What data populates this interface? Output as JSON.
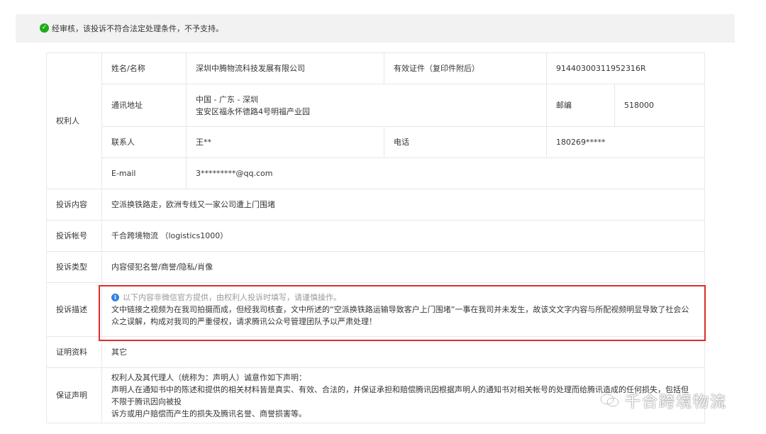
{
  "notice": {
    "text": "经审核，该投诉不符合法定处理条件，不予支持。"
  },
  "rights_holder": {
    "section_label": "权利人",
    "name_label": "姓名/名称",
    "name_value": "深圳中腾物流科技发展有限公司",
    "id_label": "有效证件（复印件附后）",
    "id_value": "91440300311952316R",
    "address_label": "通讯地址",
    "address_line1": "中国 - 广东 - 深圳",
    "address_line2": "宝安区福永怀德路4号明福产业园",
    "postcode_label": "邮编",
    "postcode_value": "518000",
    "contact_label": "联系人",
    "contact_value": "王**",
    "phone_label": "电话",
    "phone_value": "180269*****",
    "email_label": "E-mail",
    "email_value": "3*********@qq.com"
  },
  "complaint": {
    "content_label": "投诉内容",
    "content_value": "空派换铁路走，欧洲专线又一家公司遭上门围堵",
    "account_label": "投诉帐号",
    "account_value": "千合跨境物流 （logistics1000）",
    "type_label": "投诉类型",
    "type_value": "内容侵犯名誉/商誉/隐私/肖像",
    "desc_label": "投诉描述",
    "desc_tip": "以下内容非微信官方提供，由权利人投诉时填写，请谨慎操作。",
    "desc_text": "文中链接之视频为在我司拍摄而成，但经我司核查，文中所述的“空派换铁路运输导致客户上门围堵”一事在我司并未发生，故该文文字内容与所配视频明显导致了社会公众之误解，构成对我司的严重侵权，请求腾讯公众号管理团队予以严肃处理！",
    "evidence_label": "证明资料",
    "evidence_value": "其它",
    "guarantee_label": "保证声明",
    "guarantee_line1": "权利人及其代理人（统称为：声明人）诚意作如下声明：",
    "guarantee_line2": "声明人在通知书中的陈述和提供的相关材料皆是真实、有效、合法的，并保证承担和赔偿腾讯因根据声明人的通知书对相关帐号的处理而给腾讯造成的任何损失，包括但不限于腾讯因向被投",
    "guarantee_line3": "诉方或用户赔偿而产生的损失及腾讯名誉、商誉损害等。"
  },
  "watermark": {
    "text": "千合跨境物流"
  }
}
